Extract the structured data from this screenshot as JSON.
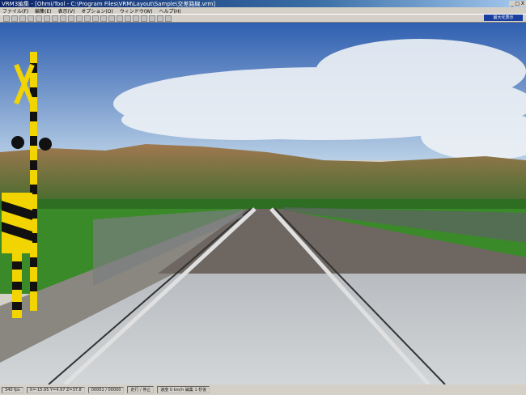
{
  "title": "VRM3編集 - [Ohmi/Tool - C:\\Program Files\\VRM\\Layout\\Sample\\交差路線.vrm]",
  "window_controls": "_ □ X",
  "menu": [
    "ファイル(F)",
    "編集(E)",
    "表示(V)",
    "オプション(O)",
    "ウィンドウ(W)",
    "ヘルプ(H)"
  ],
  "toolbar_icons": [
    "line-tool-icon",
    "rail-icon",
    "grid-icon",
    "select-icon",
    "circle-icon",
    "train-icon",
    "building-icon",
    "tree-icon",
    "signal-icon",
    "rotate-icon",
    "zoom-icon",
    "move-icon",
    "camera-icon",
    "view-icon",
    "light-icon",
    "stop-icon",
    "sound-icon",
    "crossing-icon",
    "play-icon",
    "pointer-icon",
    "help-icon"
  ],
  "view_button": "最大化表示",
  "status": [
    "340 fps",
    "X=-15.95 Y=4.97 Z=37.8",
    "00001 / 00000",
    "走行 / 停止",
    "速度 0 km/h 編集 1 秒後"
  ],
  "colors": {
    "sky_top": "#3d6ec0",
    "sky_bottom": "#a9c4e0",
    "grass": "#3a8a2a",
    "rail": "#d8d8d8",
    "crossing_yellow": "#f2d400"
  }
}
